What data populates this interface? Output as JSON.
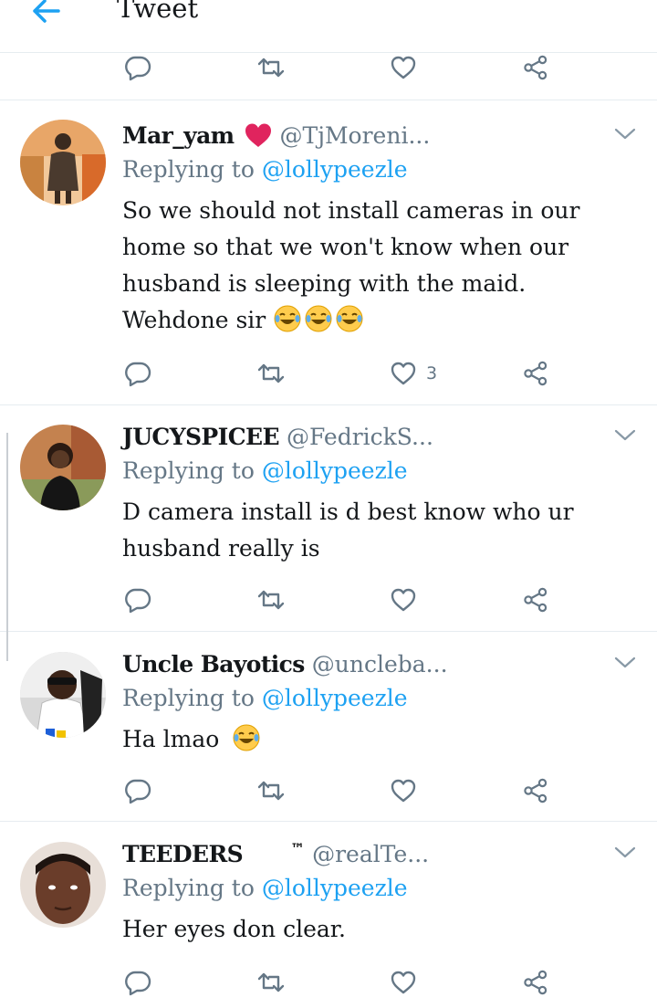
{
  "header": {
    "title": "Tweet"
  },
  "reply_to_prefix": "Replying to",
  "tweets": [
    {
      "name": "Mar_yam",
      "name_badge": "heart",
      "handle": "@TjMoreni...",
      "mention": "@lollypeezle",
      "text": "So we should not install cameras in our home so that we won't know when our husband is sleeping with the maid. Wehdone sir",
      "emojis": 3,
      "like_count": "3"
    },
    {
      "name": "JUCYSPICEE",
      "handle": "@FedrickS...",
      "mention": "@lollypeezle",
      "text": "D camera install is d best know who ur husband really is",
      "emojis": 0,
      "like_count": ""
    },
    {
      "name": "Uncle Bayotics",
      "handle": "@uncleba...",
      "mention": "@lollypeezle",
      "text": "Ha lmao",
      "emojis": 1,
      "like_count": ""
    },
    {
      "name": "TEEDERS",
      "name_suffix": "™",
      "handle": "@realTe...",
      "mention": "@lollypeezle",
      "text": "Her eyes don clear.",
      "emojis": 0,
      "like_count": ""
    }
  ],
  "icons": {
    "back": "arrow-left-icon",
    "reply": "reply-icon",
    "retweet": "retweet-icon",
    "like": "heart-icon",
    "share": "share-icon",
    "caret": "chevron-down-icon",
    "emoji": "tears-of-joy-emoji"
  },
  "colors": {
    "accent": "#1da1f2",
    "secondary_text": "#657786",
    "icon_gray": "#657786",
    "heart_red": "#e0245e",
    "divider": "#e6ecf0"
  }
}
